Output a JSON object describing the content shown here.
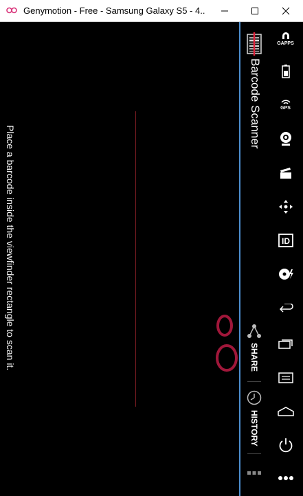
{
  "window": {
    "title": "Genymotion - Free - Samsung Galaxy S5 - 4....",
    "controls": [
      "minimize",
      "maximize",
      "close"
    ]
  },
  "app": {
    "title": "Barcode Scanner",
    "hint": "Place a barcode inside the viewfinder rectangle to scan it.",
    "actions": {
      "share_label": "SHARE",
      "history_label": "HISTORY"
    }
  },
  "sidebar": {
    "items": [
      {
        "icon": "gapps-icon",
        "caption": "GAPPS"
      },
      {
        "icon": "battery-icon",
        "caption": ""
      },
      {
        "icon": "gps-icon",
        "caption": "GPS"
      },
      {
        "icon": "webcam-icon",
        "caption": ""
      },
      {
        "icon": "video-capture-icon",
        "caption": ""
      },
      {
        "icon": "remote-control-icon",
        "caption": ""
      },
      {
        "icon": "id-icon",
        "caption": ""
      },
      {
        "icon": "disk-icon",
        "caption": ""
      },
      {
        "icon": "back-icon",
        "caption": ""
      },
      {
        "icon": "recent-apps-icon",
        "caption": ""
      },
      {
        "icon": "menu-icon",
        "caption": ""
      },
      {
        "icon": "home-icon",
        "caption": ""
      },
      {
        "icon": "power-icon",
        "caption": ""
      },
      {
        "icon": "more-icon",
        "caption": ""
      }
    ]
  },
  "colors": {
    "accent_line": "#4d8fcf",
    "laser": "#7a1c22",
    "rings": "#a0173a"
  }
}
